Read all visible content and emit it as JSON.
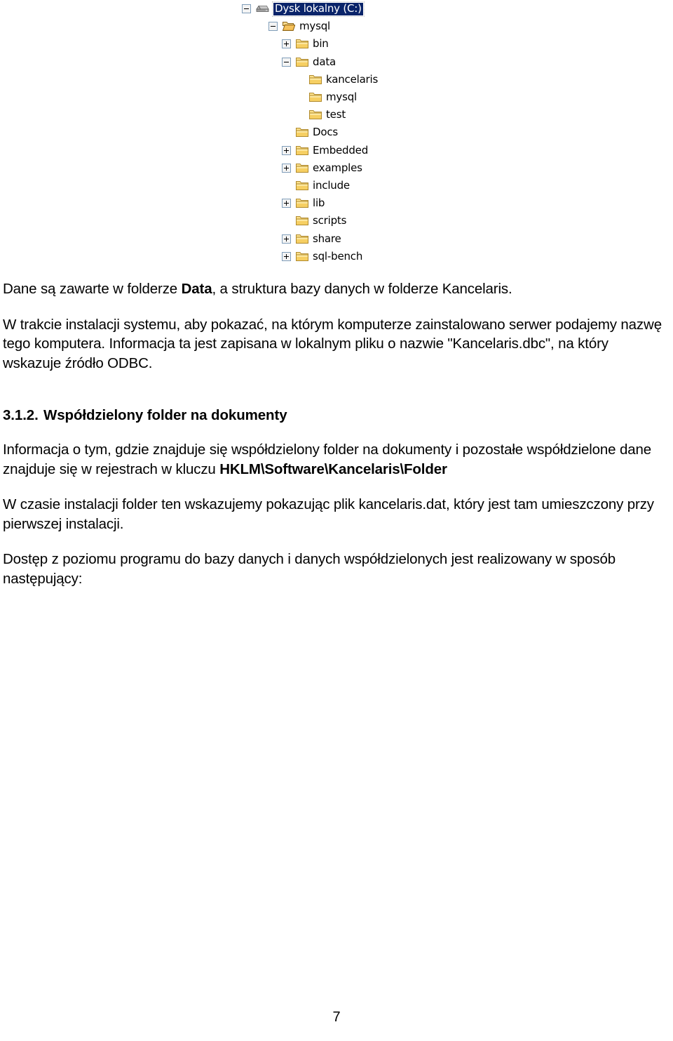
{
  "figure": {
    "name": "windows-explorer-folder-tree",
    "selection_bg": "#0a246a",
    "selection_fg": "#ffffff",
    "nodes": [
      {
        "label": "Dysk lokalny (C:)",
        "level": 0,
        "icon": "hard-drive-icon",
        "toggle": "minus",
        "selected": true
      },
      {
        "label": "mysql",
        "level": 1,
        "icon": "open-folder-icon",
        "toggle": "minus",
        "selected": false
      },
      {
        "label": "bin",
        "level": 2,
        "icon": "folder-icon",
        "toggle": "plus",
        "selected": false
      },
      {
        "label": "data",
        "level": 2,
        "icon": "folder-icon",
        "toggle": "minus",
        "selected": false
      },
      {
        "label": "kancelaris",
        "level": 3,
        "icon": "folder-icon",
        "toggle": "none",
        "selected": false
      },
      {
        "label": "mysql",
        "level": 3,
        "icon": "folder-icon",
        "toggle": "none",
        "selected": false
      },
      {
        "label": "test",
        "level": 3,
        "icon": "folder-icon",
        "toggle": "none",
        "selected": false
      },
      {
        "label": "Docs",
        "level": 2,
        "icon": "folder-icon",
        "toggle": "none",
        "selected": false
      },
      {
        "label": "Embedded",
        "level": 2,
        "icon": "folder-icon",
        "toggle": "plus",
        "selected": false
      },
      {
        "label": "examples",
        "level": 2,
        "icon": "folder-icon",
        "toggle": "plus",
        "selected": false
      },
      {
        "label": "include",
        "level": 2,
        "icon": "folder-icon",
        "toggle": "none",
        "selected": false
      },
      {
        "label": "lib",
        "level": 2,
        "icon": "folder-icon",
        "toggle": "plus",
        "selected": false
      },
      {
        "label": "scripts",
        "level": 2,
        "icon": "folder-icon",
        "toggle": "none",
        "selected": false
      },
      {
        "label": "share",
        "level": 2,
        "icon": "folder-icon",
        "toggle": "plus",
        "selected": false
      },
      {
        "label": "sql-bench",
        "level": 2,
        "icon": "folder-icon",
        "toggle": "plus",
        "selected": false
      }
    ]
  },
  "document": {
    "paragraph_1": {
      "before_bold": "Dane są zawarte w folderze ",
      "bold": "Data",
      "after_bold": ", a struktura bazy danych w folderze Kancelaris."
    },
    "paragraph_2": "W trakcie instalacji systemu, aby pokazać, na którym komputerze zainstalowano serwer podajemy nazwę tego komputera. Informacja ta jest zapisana w lokalnym pliku o nazwie \"Kancelaris.dbc\", na który wskazuje źródło ODBC.",
    "heading": {
      "number": "3.1.2.",
      "title": "Współdzielony folder na dokumenty"
    },
    "paragraph_3": {
      "before_bold": "Informacja o tym, gdzie znajduje się współdzielony folder na dokumenty i pozostałe współdzielone dane znajduje się w rejestrach w kluczu ",
      "bold": "HKLM\\Software\\Kancelaris\\Folder",
      "after_bold": ""
    },
    "paragraph_4": "W czasie instalacji folder ten wskazujemy pokazując plik kancelaris.dat, który jest tam umieszczony przy pierwszej instalacji.",
    "paragraph_5": "Dostęp z poziomu programu do bazy danych i danych współdzielonych jest realizowany w sposób następujący:",
    "page_number": "7"
  }
}
